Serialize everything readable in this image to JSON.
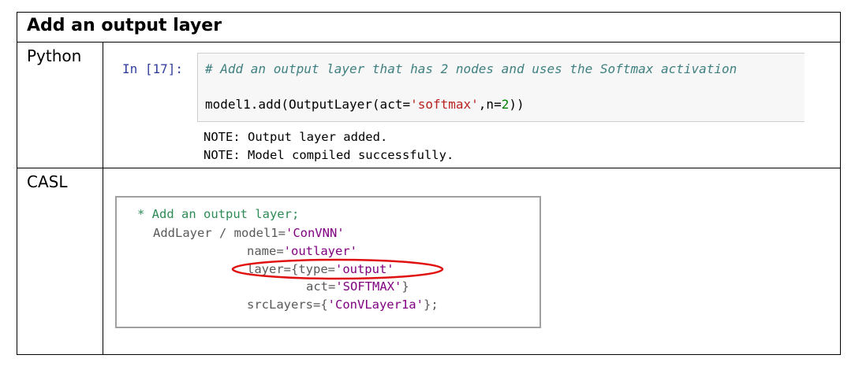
{
  "title": "Add an output layer",
  "rows": [
    {
      "label": "Python"
    },
    {
      "label": "CASL"
    }
  ],
  "python": {
    "prompt": "In [17]:",
    "comment": "# Add an output layer that has 2 nodes and uses the Softmax activation",
    "code": {
      "prefix": "model1.add(OutputLayer(act=",
      "act_value": "'softmax'",
      "mid": ",n=",
      "n_value": "2",
      "suffix": "))"
    },
    "output": [
      "NOTE: Output layer added.",
      "NOTE: Model compiled successfully."
    ]
  },
  "casl": {
    "comment": "* Add an output layer;",
    "line2_a": "AddLayer / model1=",
    "line2_b": "'ConVNN'",
    "line3_a": "name=",
    "line3_b": "'outlayer'",
    "line4_a": "layer={type=",
    "line4_b": "'output'",
    "line5_a": "act=",
    "line5_b": "'SOFTMAX'",
    "line5_c": "}",
    "line6_a": "srcLayers={",
    "line6_b": "'ConVLayer1a'",
    "line6_c": "};"
  },
  "colors": {
    "highlight_ellipse": "#e01010",
    "prompt": "#303f9f",
    "comment": "#408080",
    "string": "#ba2121"
  }
}
